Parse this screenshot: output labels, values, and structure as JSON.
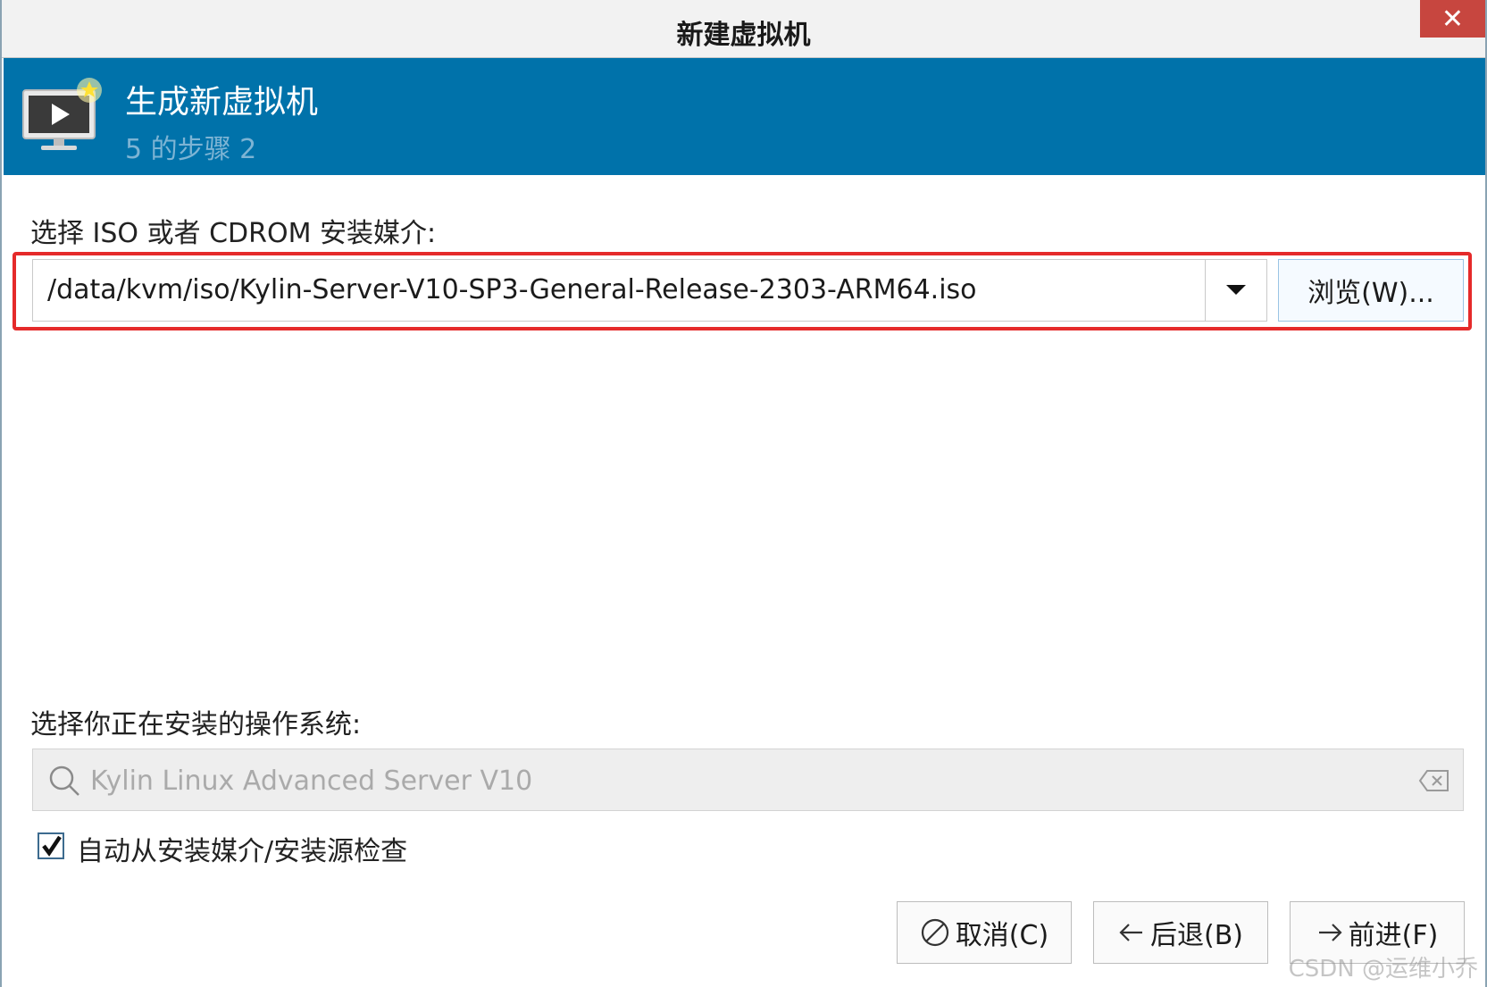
{
  "window": {
    "title": "新建虚拟机",
    "close_label": "✕"
  },
  "banner": {
    "title": "生成新虚拟机",
    "step": "5 的步骤 2"
  },
  "media": {
    "label": "选择 ISO 或者 CDROM 安装媒介:",
    "iso_path": "/data/kvm/iso/Kylin-Server-V10-SP3-General-Release-2303-ARM64.iso",
    "browse_label": "浏览(W)..."
  },
  "os": {
    "label": "选择你正在安装的操作系统:",
    "search_placeholder": "Kylin Linux Advanced Server V10"
  },
  "auto_detect": {
    "label": "自动从安装媒介/安装源检查",
    "checked": true
  },
  "buttons": {
    "cancel": "取消(C)",
    "back": "后退(B)",
    "forward": "前进(F)"
  },
  "watermark": "CSDN @运维小乔",
  "colors": {
    "banner": "#0072aa",
    "highlight": "#e52a2a",
    "close": "#c7463f"
  }
}
